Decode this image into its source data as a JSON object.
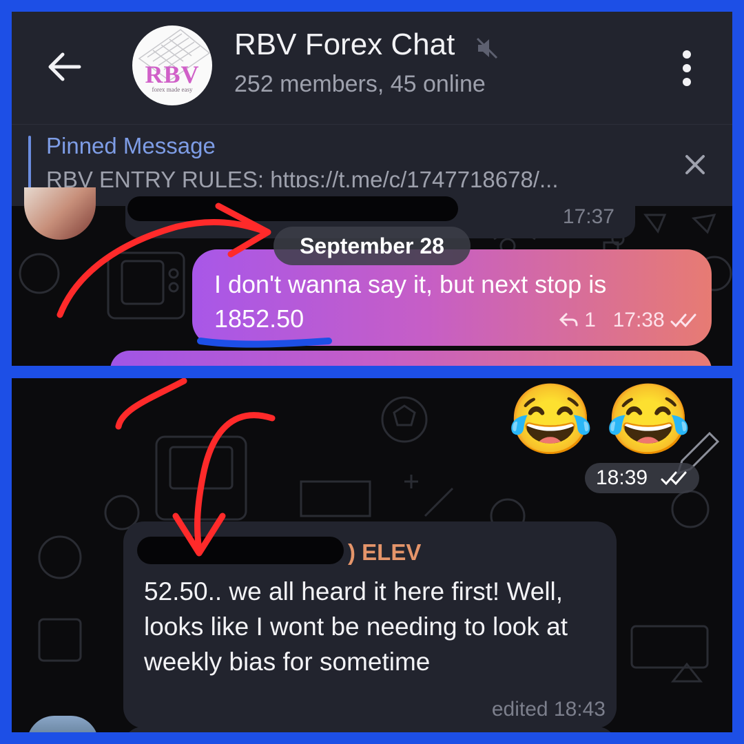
{
  "header": {
    "title": "RBV Forex Chat",
    "subtitle": "252 members, 45 online",
    "avatar_text": "RBV",
    "avatar_tagline": "forex made easy"
  },
  "pinned": {
    "title": "Pinned Message",
    "text": "RBV ENTRY RULES: https://t.me/c/1747718678/..."
  },
  "chat": {
    "prev_time": "17:37",
    "date_separator": "September 28",
    "outgoing": {
      "text": "I don't wanna say it, but next stop is 1852.50",
      "reply_count": "1",
      "time": "17:38"
    },
    "emoji_message": {
      "emojis": [
        "😂",
        "😂"
      ],
      "time": "18:39"
    },
    "incoming": {
      "sender_suffix": ") ELEV",
      "text": "52.50.. we all heard it here first! Well, looks like I wont be needing to look at weekly bias for sometime",
      "meta": "edited 18:43"
    }
  },
  "colors": {
    "frame": "#1d4fe6",
    "header_bg": "#22242e",
    "accent_link": "#7e9de6",
    "sender_name": "#e5956a",
    "annotation": "#ff2a2a",
    "underline": "#1d4fe6"
  }
}
